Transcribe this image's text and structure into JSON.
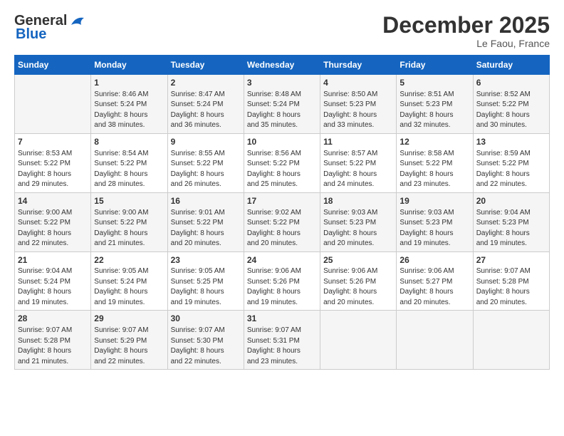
{
  "header": {
    "logo_line1": "General",
    "logo_line2": "Blue",
    "month": "December 2025",
    "location": "Le Faou, France"
  },
  "weekdays": [
    "Sunday",
    "Monday",
    "Tuesday",
    "Wednesday",
    "Thursday",
    "Friday",
    "Saturday"
  ],
  "weeks": [
    [
      {
        "day": "",
        "info": ""
      },
      {
        "day": "1",
        "info": "Sunrise: 8:46 AM\nSunset: 5:24 PM\nDaylight: 8 hours\nand 38 minutes."
      },
      {
        "day": "2",
        "info": "Sunrise: 8:47 AM\nSunset: 5:24 PM\nDaylight: 8 hours\nand 36 minutes."
      },
      {
        "day": "3",
        "info": "Sunrise: 8:48 AM\nSunset: 5:24 PM\nDaylight: 8 hours\nand 35 minutes."
      },
      {
        "day": "4",
        "info": "Sunrise: 8:50 AM\nSunset: 5:23 PM\nDaylight: 8 hours\nand 33 minutes."
      },
      {
        "day": "5",
        "info": "Sunrise: 8:51 AM\nSunset: 5:23 PM\nDaylight: 8 hours\nand 32 minutes."
      },
      {
        "day": "6",
        "info": "Sunrise: 8:52 AM\nSunset: 5:22 PM\nDaylight: 8 hours\nand 30 minutes."
      }
    ],
    [
      {
        "day": "7",
        "info": "Sunrise: 8:53 AM\nSunset: 5:22 PM\nDaylight: 8 hours\nand 29 minutes."
      },
      {
        "day": "8",
        "info": "Sunrise: 8:54 AM\nSunset: 5:22 PM\nDaylight: 8 hours\nand 28 minutes."
      },
      {
        "day": "9",
        "info": "Sunrise: 8:55 AM\nSunset: 5:22 PM\nDaylight: 8 hours\nand 26 minutes."
      },
      {
        "day": "10",
        "info": "Sunrise: 8:56 AM\nSunset: 5:22 PM\nDaylight: 8 hours\nand 25 minutes."
      },
      {
        "day": "11",
        "info": "Sunrise: 8:57 AM\nSunset: 5:22 PM\nDaylight: 8 hours\nand 24 minutes."
      },
      {
        "day": "12",
        "info": "Sunrise: 8:58 AM\nSunset: 5:22 PM\nDaylight: 8 hours\nand 23 minutes."
      },
      {
        "day": "13",
        "info": "Sunrise: 8:59 AM\nSunset: 5:22 PM\nDaylight: 8 hours\nand 22 minutes."
      }
    ],
    [
      {
        "day": "14",
        "info": "Sunrise: 9:00 AM\nSunset: 5:22 PM\nDaylight: 8 hours\nand 22 minutes."
      },
      {
        "day": "15",
        "info": "Sunrise: 9:00 AM\nSunset: 5:22 PM\nDaylight: 8 hours\nand 21 minutes."
      },
      {
        "day": "16",
        "info": "Sunrise: 9:01 AM\nSunset: 5:22 PM\nDaylight: 8 hours\nand 20 minutes."
      },
      {
        "day": "17",
        "info": "Sunrise: 9:02 AM\nSunset: 5:22 PM\nDaylight: 8 hours\nand 20 minutes."
      },
      {
        "day": "18",
        "info": "Sunrise: 9:03 AM\nSunset: 5:23 PM\nDaylight: 8 hours\nand 20 minutes."
      },
      {
        "day": "19",
        "info": "Sunrise: 9:03 AM\nSunset: 5:23 PM\nDaylight: 8 hours\nand 19 minutes."
      },
      {
        "day": "20",
        "info": "Sunrise: 9:04 AM\nSunset: 5:23 PM\nDaylight: 8 hours\nand 19 minutes."
      }
    ],
    [
      {
        "day": "21",
        "info": "Sunrise: 9:04 AM\nSunset: 5:24 PM\nDaylight: 8 hours\nand 19 minutes."
      },
      {
        "day": "22",
        "info": "Sunrise: 9:05 AM\nSunset: 5:24 PM\nDaylight: 8 hours\nand 19 minutes."
      },
      {
        "day": "23",
        "info": "Sunrise: 9:05 AM\nSunset: 5:25 PM\nDaylight: 8 hours\nand 19 minutes."
      },
      {
        "day": "24",
        "info": "Sunrise: 9:06 AM\nSunset: 5:26 PM\nDaylight: 8 hours\nand 19 minutes."
      },
      {
        "day": "25",
        "info": "Sunrise: 9:06 AM\nSunset: 5:26 PM\nDaylight: 8 hours\nand 20 minutes."
      },
      {
        "day": "26",
        "info": "Sunrise: 9:06 AM\nSunset: 5:27 PM\nDaylight: 8 hours\nand 20 minutes."
      },
      {
        "day": "27",
        "info": "Sunrise: 9:07 AM\nSunset: 5:28 PM\nDaylight: 8 hours\nand 20 minutes."
      }
    ],
    [
      {
        "day": "28",
        "info": "Sunrise: 9:07 AM\nSunset: 5:28 PM\nDaylight: 8 hours\nand 21 minutes."
      },
      {
        "day": "29",
        "info": "Sunrise: 9:07 AM\nSunset: 5:29 PM\nDaylight: 8 hours\nand 22 minutes."
      },
      {
        "day": "30",
        "info": "Sunrise: 9:07 AM\nSunset: 5:30 PM\nDaylight: 8 hours\nand 22 minutes."
      },
      {
        "day": "31",
        "info": "Sunrise: 9:07 AM\nSunset: 5:31 PM\nDaylight: 8 hours\nand 23 minutes."
      },
      {
        "day": "",
        "info": ""
      },
      {
        "day": "",
        "info": ""
      },
      {
        "day": "",
        "info": ""
      }
    ]
  ]
}
